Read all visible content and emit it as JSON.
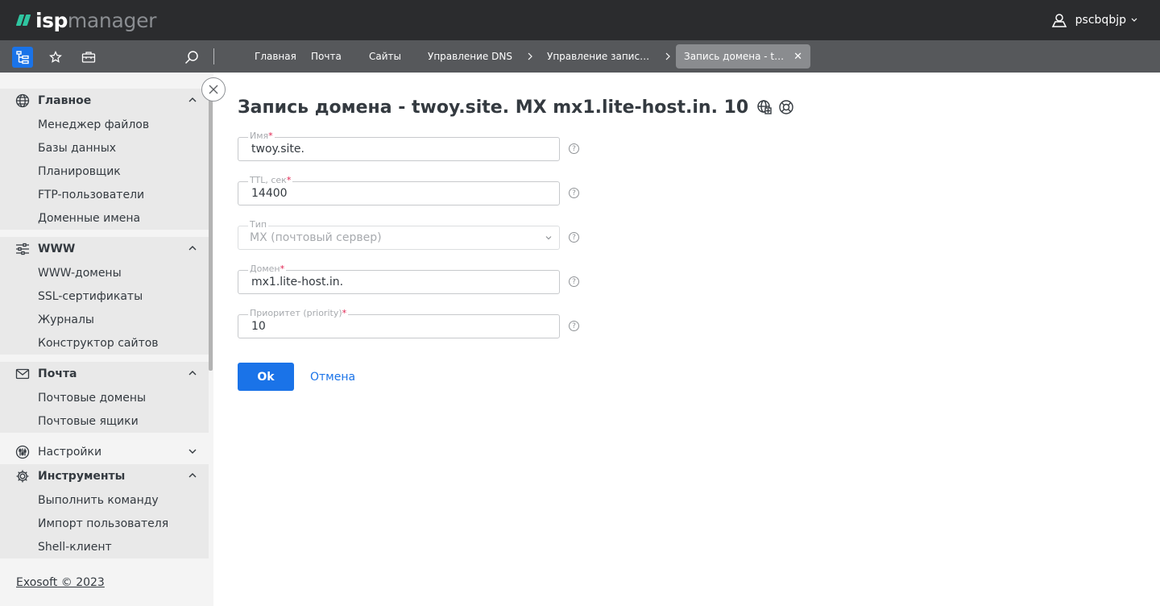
{
  "header": {
    "logo_isp": "isp",
    "logo_manager": "manager",
    "username": "pscbqbjp"
  },
  "toolbar": {
    "icons": [
      "tree-menu-icon",
      "star-icon",
      "briefcase-icon",
      "search-icon"
    ],
    "breadcrumbs": [
      "Главная",
      "Почта",
      "Сайты",
      "Управление DNS",
      "Управление запис…",
      "Запись домена - t…"
    ]
  },
  "sidebar": {
    "sections": [
      {
        "label": "Главное",
        "icon": "globe-icon",
        "expanded": true,
        "items": [
          "Менеджер файлов",
          "Базы данных",
          "Планировщик",
          "FTP-пользователи",
          "Доменные имена"
        ]
      },
      {
        "label": "WWW",
        "icon": "sliders-icon",
        "expanded": true,
        "items": [
          "WWW-домены",
          "SSL-сертификаты",
          "Журналы",
          "Конструктор сайтов"
        ]
      },
      {
        "label": "Почта",
        "icon": "envelope-icon",
        "expanded": true,
        "items": [
          "Почтовые домены",
          "Почтовые ящики"
        ]
      },
      {
        "label": "Настройки",
        "icon": "settings-sliders-icon",
        "expanded": false,
        "items": []
      },
      {
        "label": "Инструменты",
        "icon": "gear-icon",
        "expanded": true,
        "items": [
          "Выполнить команду",
          "Импорт пользователя",
          "Shell-клиент"
        ]
      }
    ],
    "footer": "Exosoft © 2023"
  },
  "form": {
    "title": "Запись домена - twoy.site. MX mx1.lite-host.in. 10",
    "fields": [
      {
        "label": "Имя",
        "required": "*",
        "value": "twoy.site."
      },
      {
        "label": "TTL, сек",
        "required": "*",
        "value": "14400"
      },
      {
        "label": "Тип",
        "required": "",
        "value": "MX (почтовый сервер)"
      },
      {
        "label": "Домен",
        "required": "*",
        "value": "mx1.lite-host.in."
      },
      {
        "label": "Приоритет (priority)",
        "required": "*",
        "value": "10"
      }
    ],
    "help_glyph": "?",
    "ok_label": "Ok",
    "cancel_label": "Отмена"
  },
  "colors": {
    "topbar": "#2b2c2e",
    "toolbar": "#56585b",
    "accent": "#1a73e8",
    "logo_green": "#2fc5a0",
    "required": "#e0214f"
  }
}
